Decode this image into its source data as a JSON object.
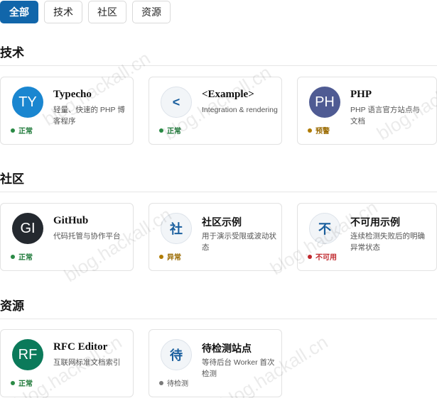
{
  "tabs": [
    {
      "label": "全部",
      "active": true
    },
    {
      "label": "技术",
      "active": false
    },
    {
      "label": "社区",
      "active": false
    },
    {
      "label": "资源",
      "active": false
    }
  ],
  "sections": [
    {
      "title": "技术",
      "cards": [
        {
          "initials": "TY",
          "avatar_color": "#1a86d0",
          "name": "Typecho",
          "desc": "轻量、快速的 PHP 博客程序",
          "status": "正常",
          "status_kind": "ok"
        },
        {
          "initials": "<",
          "avatar_color": "light",
          "name": "<Example>",
          "desc": "Integration & rendering",
          "status": "正常",
          "status_kind": "ok"
        },
        {
          "initials": "PH",
          "avatar_color": "#4f5b93",
          "name": "PHP",
          "desc": "PHP 语言官方站点与文档",
          "status": "预警",
          "status_kind": "warn"
        }
      ]
    },
    {
      "title": "社区",
      "cards": [
        {
          "initials": "GI",
          "avatar_color": "#24292f",
          "name": "GitHub",
          "desc": "代码托管与协作平台",
          "status": "正常",
          "status_kind": "ok"
        },
        {
          "initials": "社",
          "avatar_color": "light",
          "name": "社区示例",
          "desc": "用于演示受限或波动状态",
          "status": "异常",
          "status_kind": "warn"
        },
        {
          "initials": "不",
          "avatar_color": "light",
          "name": "不可用示例",
          "desc": "连续检测失败后的明确异常状态",
          "status": "不可用",
          "status_kind": "down"
        }
      ]
    },
    {
      "title": "资源",
      "cards": [
        {
          "initials": "RF",
          "avatar_color": "#0b7a5a",
          "name": "RFC Editor",
          "desc": "互联网标准文档索引",
          "status": "正常",
          "status_kind": "ok"
        },
        {
          "initials": "待",
          "avatar_color": "light",
          "name": "待检测站点",
          "desc": "等待后台 Worker 首次检测",
          "status": "待检测",
          "status_kind": "pending"
        }
      ]
    }
  ],
  "watermark": "blog.hackall.cn"
}
